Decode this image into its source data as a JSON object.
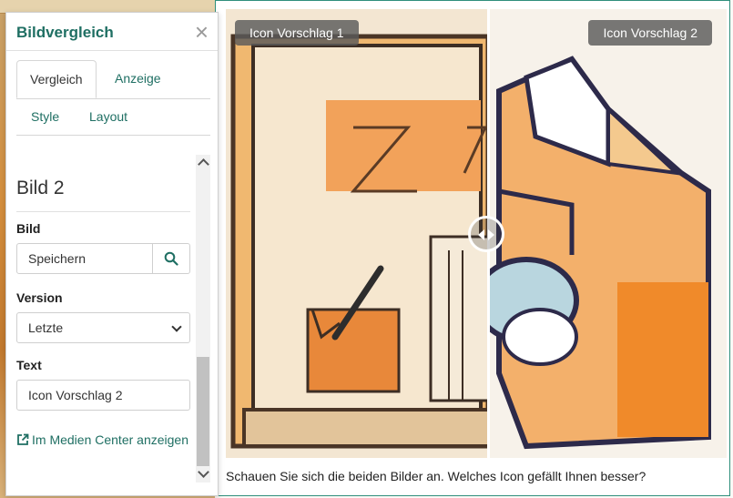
{
  "comparison": {
    "label_1": "Icon Vorschlag 1",
    "label_2": "Icon Vorschlag 2",
    "caption": "Schauen Sie sich die beiden Bilder an. Welches Icon gefällt Ihnen besser?",
    "slider_position": 0.52
  },
  "panel": {
    "title": "Bildvergleich",
    "close_symbol": "×",
    "tabs": [
      "Vergleich",
      "Anzeige",
      "Style",
      "Layout"
    ],
    "active_tab": "Vergleich",
    "section_title": "Bild 2",
    "image_label": "Bild",
    "image_value": "Speichern",
    "version_label": "Version",
    "version_value": "Letzte",
    "text_label": "Text",
    "text_value": "Icon Vorschlag 2",
    "media_link": "Im Medien Center anzeigen"
  },
  "colors": {
    "accent": "#1f6f63",
    "card_border": "#2f8f7c",
    "label_bg": "#5a5a5a"
  },
  "icons": [
    "close-icon",
    "search-icon",
    "external-link-icon",
    "slider-handle-icon",
    "scroll-up-icon",
    "scroll-down-icon"
  ]
}
